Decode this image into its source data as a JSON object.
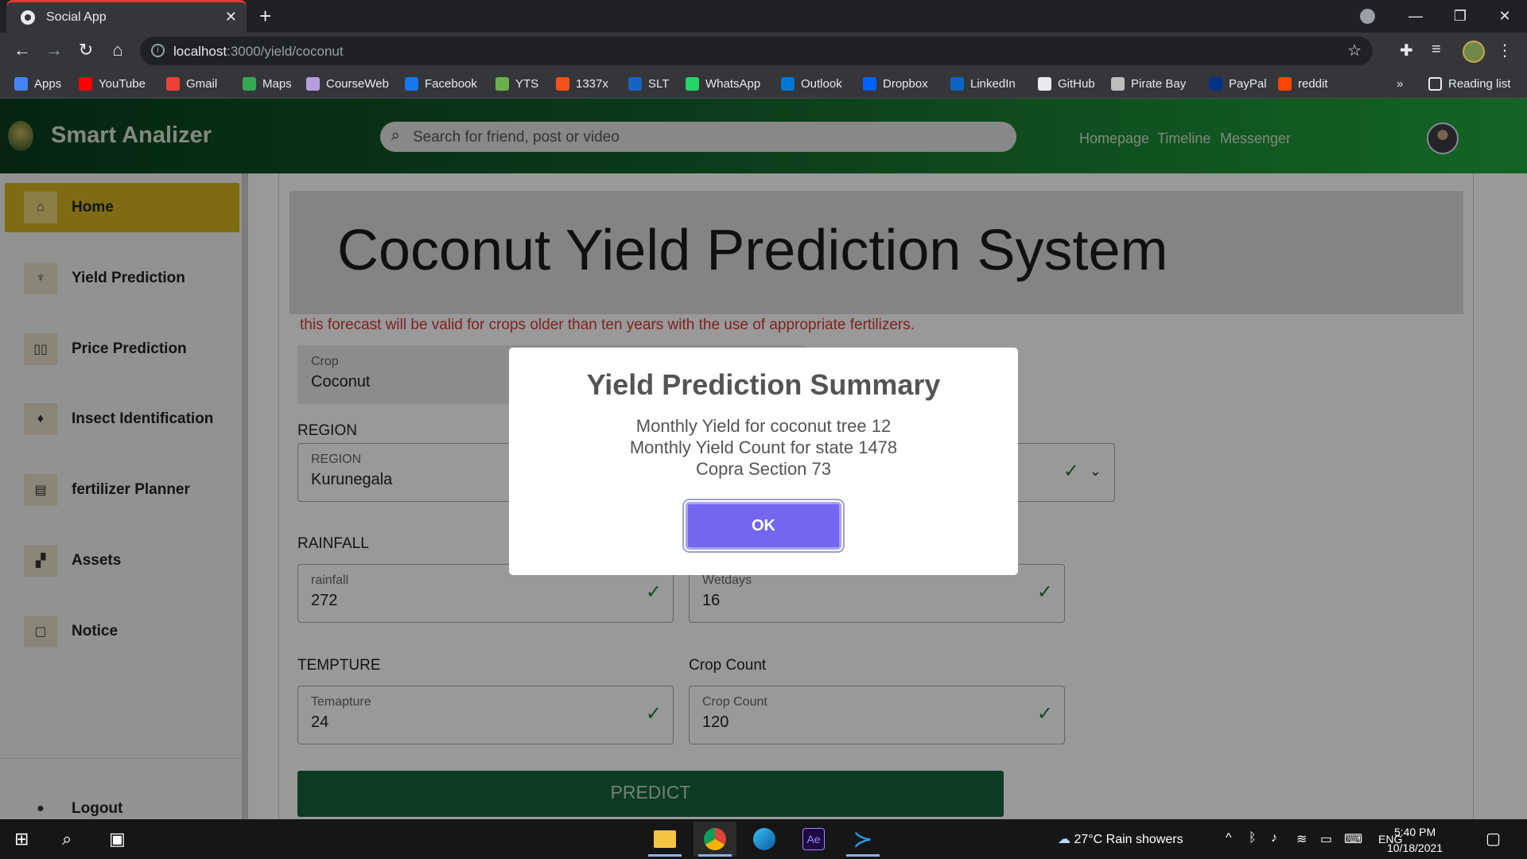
{
  "browser": {
    "tab_title": "Social App",
    "url_host": "localhost",
    "url_rest": ":3000/yield/coconut",
    "bookmarks": [
      {
        "label": "Apps",
        "color": "#4285f4"
      },
      {
        "label": "YouTube",
        "color": "#ff0000"
      },
      {
        "label": "Gmail",
        "color": "#ea4335"
      },
      {
        "label": "Maps",
        "color": "#34a853"
      },
      {
        "label": "CourseWeb",
        "color": "#b39ddb"
      },
      {
        "label": "Facebook",
        "color": "#1877f2"
      },
      {
        "label": "YTS",
        "color": "#6ab04c"
      },
      {
        "label": "1337x",
        "color": "#f4511e"
      },
      {
        "label": "SLT",
        "color": "#1565c0"
      },
      {
        "label": "WhatsApp",
        "color": "#25d366"
      },
      {
        "label": "Outlook",
        "color": "#0078d4"
      },
      {
        "label": "Dropbox",
        "color": "#0061ff"
      },
      {
        "label": "LinkedIn",
        "color": "#0a66c2"
      },
      {
        "label": "GitHub",
        "color": "#e8eaed"
      },
      {
        "label": "Pirate Bay",
        "color": "#bdbdbd"
      },
      {
        "label": "PayPal",
        "color": "#003087"
      },
      {
        "label": "reddit",
        "color": "#ff4500"
      }
    ],
    "reading_list": "Reading list",
    "more": "»"
  },
  "app": {
    "brand": "Smart Analizer",
    "search_placeholder": "Search for friend, post or video",
    "nav": [
      "Homepage",
      "Timeline",
      "Messenger"
    ]
  },
  "sidebar": {
    "items": [
      {
        "label": "Home",
        "icon": "home-icon"
      },
      {
        "label": "Yield Prediction",
        "icon": "tree-icon"
      },
      {
        "label": "Price Prediction",
        "icon": "book-icon"
      },
      {
        "label": "Insect Identification",
        "icon": "bug-icon"
      },
      {
        "label": "fertilizer Planner",
        "icon": "document-icon"
      },
      {
        "label": "Assets",
        "icon": "boxes-icon"
      },
      {
        "label": "Notice",
        "icon": "file-icon"
      }
    ],
    "logout": "Logout"
  },
  "main": {
    "title": "Coconut Yield Prediction System",
    "warning": "this forecast will be valid for crops older than ten years with the use of appropriate fertilizers.",
    "crop": {
      "label": "Crop",
      "value": "Coconut"
    },
    "region_heading": "REGION",
    "region": {
      "label": "REGION",
      "value": "Kurunegala"
    },
    "rainfall_heading": "RAINFALL",
    "rainfall": {
      "label": "rainfall",
      "value": "272"
    },
    "wetdays": {
      "label": "Wetdays",
      "value": "16"
    },
    "temp_heading": "TEMPTURE",
    "temp": {
      "label": "Temapture",
      "value": "24"
    },
    "cropcount_heading": "Crop Count",
    "cropcount": {
      "label": "Crop Count",
      "value": "120"
    },
    "predict": "PREDICT"
  },
  "modal": {
    "title": "Yield Prediction Summary",
    "line1": "Monthly Yield for coconut tree 12",
    "line2": "Monthly Yield Count for state 1478",
    "line3": "Copra Section 73",
    "ok": "OK"
  },
  "taskbar": {
    "weather": "27°C  Rain showers",
    "lang": "ENG",
    "time": "5:40 PM",
    "date": "10/18/2021"
  }
}
